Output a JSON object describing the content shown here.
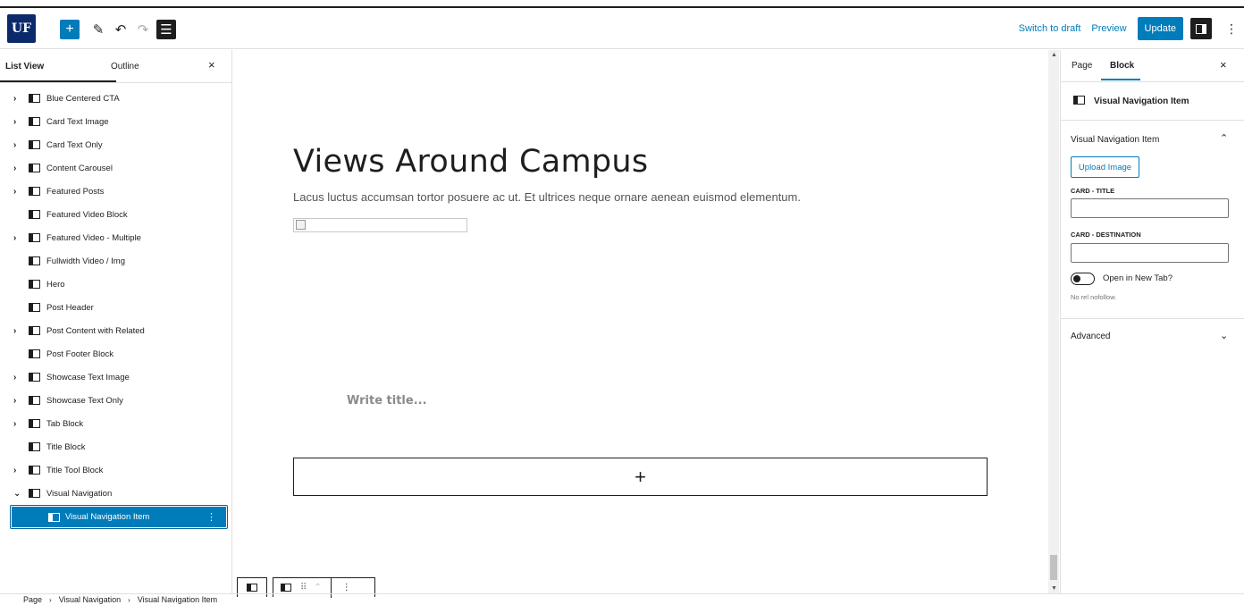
{
  "toolbar": {
    "logo": "UF",
    "add_icon": "+",
    "edit_icon": "✎",
    "undo_icon": "↶",
    "redo_icon": "↷",
    "list_icon": "☰",
    "switch_to_draft": "Switch to draft",
    "preview": "Preview",
    "update": "Update",
    "more_icon": "⋮"
  },
  "left_panel": {
    "tab_list_view": "List View",
    "tab_outline": "Outline",
    "close_icon": "×",
    "items": [
      {
        "label": "Blue Centered CTA",
        "chevron": "›"
      },
      {
        "label": "Card Text Image",
        "chevron": "›"
      },
      {
        "label": "Card Text Only",
        "chevron": "›"
      },
      {
        "label": "Content Carousel",
        "chevron": "›"
      },
      {
        "label": "Featured Posts",
        "chevron": "›"
      },
      {
        "label": "Featured Video Block",
        "chevron": ""
      },
      {
        "label": "Featured Video - Multiple",
        "chevron": "›"
      },
      {
        "label": "Fullwidth Video / Img",
        "chevron": ""
      },
      {
        "label": "Hero",
        "chevron": ""
      },
      {
        "label": "Post Header",
        "chevron": ""
      },
      {
        "label": "Post Content with Related",
        "chevron": "›"
      },
      {
        "label": "Post Footer Block",
        "chevron": ""
      },
      {
        "label": "Showcase Text Image",
        "chevron": "›"
      },
      {
        "label": "Showcase Text Only",
        "chevron": "›"
      },
      {
        "label": "Tab Block",
        "chevron": "›"
      },
      {
        "label": "Title Block",
        "chevron": ""
      },
      {
        "label": "Title Tool Block",
        "chevron": "›"
      },
      {
        "label": "Visual Navigation",
        "chevron": "⌄"
      }
    ],
    "selected_item": "Visual Navigation Item",
    "selected_more": "⋮"
  },
  "canvas": {
    "title": "Views Around Campus",
    "description": "Lacus luctus accumsan tortor posuere ac ut. Et ultrices neque ornare aenean euismod elementum.",
    "title_placeholder": "Write title...",
    "appender_icon": "+",
    "block_toolbar_drag": "⠿",
    "block_toolbar_up": "⌃",
    "block_toolbar_more": "⋮"
  },
  "scrollbar": {
    "up": "▲",
    "down": "▼"
  },
  "right_panel": {
    "tab_page": "Page",
    "tab_block": "Block",
    "close_icon": "×",
    "block_card_title": "Visual Navigation Item",
    "section_title": "Visual Navigation Item",
    "section_chevron": "⌃",
    "upload_image": "Upload Image",
    "card_title_label": "CARD - TITLE",
    "card_title_value": "",
    "card_destination_label": "CARD - DESTINATION",
    "card_destination_value": "",
    "toggle_label": "Open in New Tab?",
    "toggle_on": false,
    "help_text": "No rel nofollow.",
    "advanced": "Advanced",
    "advanced_chevron": "⌄"
  },
  "breadcrumb": {
    "items": [
      "Page",
      "Visual Navigation",
      "Visual Navigation Item"
    ],
    "separator": "›"
  },
  "colors": {
    "accent": "#007cba",
    "logo_bg": "#0b2a6b",
    "dark": "#1e1e1e"
  }
}
